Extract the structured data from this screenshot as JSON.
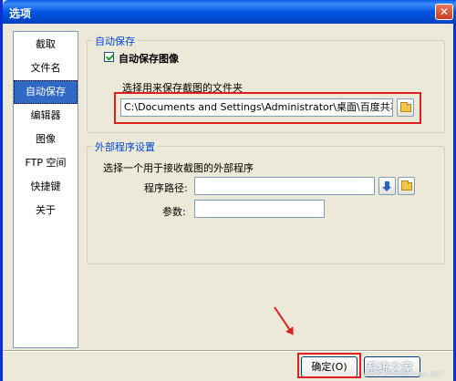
{
  "window": {
    "title": "选项",
    "close_glyph": "✕"
  },
  "sidebar": {
    "items": [
      {
        "label": "截取",
        "selected": false
      },
      {
        "label": "文件名",
        "selected": false
      },
      {
        "label": "自动保存",
        "selected": true
      },
      {
        "label": "编辑器",
        "selected": false
      },
      {
        "label": "图像",
        "selected": false
      },
      {
        "label": "FTP 空间",
        "selected": false
      },
      {
        "label": "快捷键",
        "selected": false
      },
      {
        "label": "关于",
        "selected": false
      }
    ]
  },
  "autosave": {
    "group_title": "自动保存",
    "checkbox_label": "自动保存图像",
    "checked": true,
    "folder_prompt": "选择用来保存截图的文件夹",
    "folder_path": "C:\\Documents and Settings\\Administrator\\桌面\\百度共享计划"
  },
  "external": {
    "group_title": "外部程序设置",
    "prompt": "选择一个用于接收截图的外部程序",
    "path_label": "程序路径:",
    "path_value": "",
    "params_label": "参数:",
    "params_value": ""
  },
  "buttons": {
    "ok_label": "确定(O)"
  },
  "icons": {
    "browse_folder": "folder-icon",
    "dropdown": "download-arrow-icon",
    "close": "close-icon"
  },
  "colors": {
    "title_bar": "#0054e3",
    "annotation": "#e02020",
    "selection": "#316ac5"
  },
  "watermark": {
    "text": "系统之家",
    "url": "WWW.XITONGZHIJIA.NET"
  }
}
